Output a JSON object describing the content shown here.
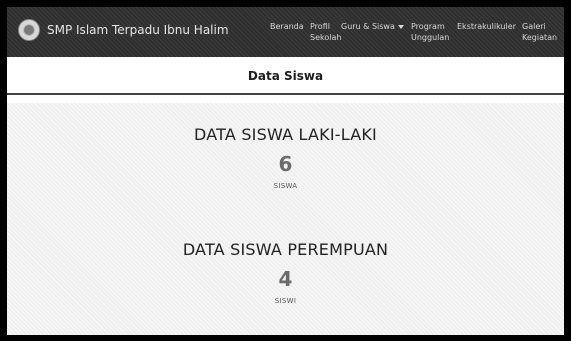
{
  "brand": {
    "name": "SMP Islam Terpadu Ibnu Halim",
    "logo_icon": "school-emblem-icon"
  },
  "nav": {
    "beranda": "Beranda",
    "profil_line1": "Profil",
    "profil_line2": "Sekolah",
    "guru_siswa": "Guru & Siswa",
    "program_line1": "Program",
    "program_line2": "Unggulan",
    "ekstrakurikuler": "Ekstrakulikuler",
    "galeri_line1": "Galeri",
    "galeri_line2": "Kegiatan"
  },
  "page": {
    "title": "Data Siswa"
  },
  "stats": {
    "male": {
      "heading": "DATA SISWA LAKI-LAKI",
      "count": "6",
      "unit": "SISWA"
    },
    "female": {
      "heading": "DATA SISWA PEREMPUAN",
      "count": "4",
      "unit": "SISWI"
    }
  }
}
